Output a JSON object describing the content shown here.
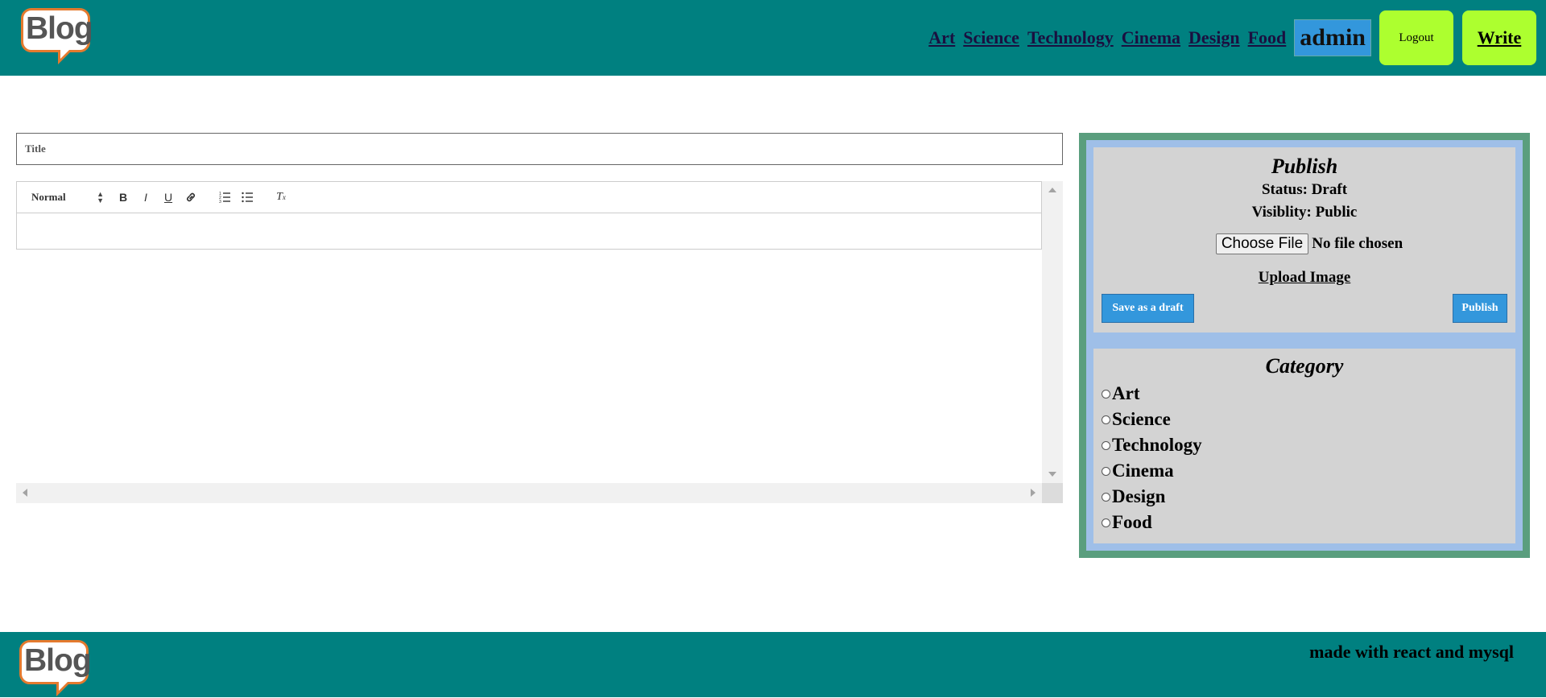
{
  "header": {
    "logo_text": "Blog",
    "nav": [
      "Art",
      "Science",
      "Technology",
      "Cinema",
      "Design",
      "Food"
    ],
    "username": "admin",
    "logout_label": "Logout",
    "write_label": "Write"
  },
  "editor": {
    "title_placeholder": "Title",
    "format_select": "Normal",
    "toolbar_icons": [
      "bold-icon",
      "italic-icon",
      "underline-icon",
      "link-icon",
      "ordered-list-icon",
      "bullet-list-icon",
      "clear-format-icon"
    ]
  },
  "publish": {
    "title": "Publish",
    "status": "Status: Draft",
    "visibility": "Visiblity: Public",
    "choose_file_label": "Choose File",
    "file_status": "No file chosen",
    "upload_label": "Upload Image",
    "save_draft_label": "Save as a draft",
    "publish_label": "Publish"
  },
  "category": {
    "title": "Category",
    "items": [
      "Art",
      "Science",
      "Technology",
      "Cinema",
      "Design",
      "Food"
    ]
  },
  "footer": {
    "logo_text": "Blog",
    "text": "made with react and mysql"
  },
  "colors": {
    "header_bg": "#008080",
    "button_green": "#adff2f",
    "accent_blue": "#3397dc",
    "panel_border": "#5a9e7e",
    "panel_bg": "#9fbfe8",
    "card_bg": "#d3d3d3"
  }
}
